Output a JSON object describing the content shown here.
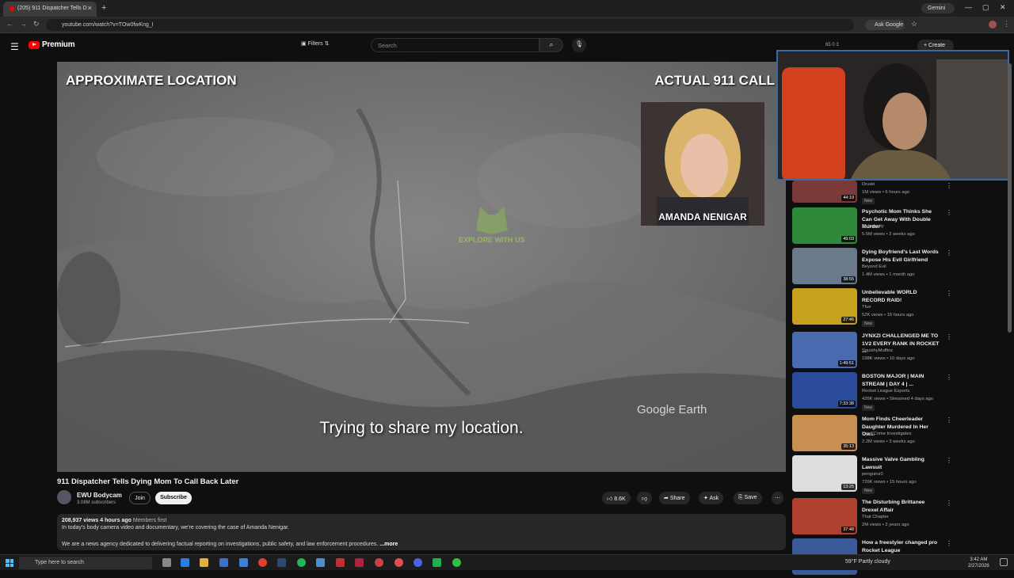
{
  "browser": {
    "tab_title": "(205) 911 Dispatcher Tells D",
    "url": "youtube.com/watch?v=TOw0fwKng_I",
    "gemini_label": "Gemini",
    "ask_google_label": "Ask Google"
  },
  "youtube": {
    "logo_text": "Premium",
    "filters_label": "Filters",
    "search_placeholder": "Search",
    "create_label": "Create",
    "header_stats": "65  0  3"
  },
  "video": {
    "overlay_left": "APPROXIMATE LOCATION",
    "overlay_right": "ACTUAL 911 CALL",
    "caller_name": "AMANDA NENIGAR",
    "watermark": "EXPLORE WITH US",
    "map_brand": "Google Earth",
    "caption": "Trying to share my location."
  },
  "info": {
    "title": "911 Dispatcher Tells Dying Mom To Call Back Later",
    "channel": "EWU Bodycam",
    "subscribers": "3.08M subscribers",
    "join_label": "Join",
    "subscribe_label": "Subscribe",
    "likes": "8.6K",
    "share_label": "Share",
    "ask_label": "Ask",
    "save_label": "Save",
    "desc_meta": "208,937 views  4 hours ago",
    "desc_members": "Members first",
    "desc_line1": "In today's body camera video and documentary, we're covering the case of Amanda Nenigar.",
    "desc_line2": "We are a news agency dedicated to delivering factual reporting on investigations, public safety, and law enforcement procedures.",
    "desc_more": "...more"
  },
  "sidebar": [
    {
      "title": "",
      "channel": "Druski",
      "views": "1M views • 6 hours ago",
      "duration": "44:19",
      "new": "New",
      "color": "#7a3a3a"
    },
    {
      "title": "Psychotic Mom Thinks She Can Get Away With Double Murder",
      "channel": "Dr Insanity",
      "views": "5.5M views • 2 weeks ago",
      "duration": "49:03",
      "new": "",
      "color": "#2e8a3a"
    },
    {
      "title": "Dying Boyfriend's Last Words Expose His Evil Girlfriend",
      "channel": "Beyond Evil",
      "views": "1.4M views • 1 month ago",
      "duration": "38:55",
      "new": "",
      "color": "#6a7a8a"
    },
    {
      "title": "Unbelievable WORLD RECORD RAID!",
      "channel": "Tfue",
      "views": "52K views • 15 hours ago",
      "duration": "27:46",
      "new": "New",
      "color": "#c8a020"
    },
    {
      "title": "JYNXZI CHALLENGED ME TO 1V2 EVERY RANK IN ROCKET ...",
      "channel": "SquishyMuffinz",
      "views": "198K views • 10 days ago",
      "duration": "1:49:51",
      "new": "",
      "color": "#4a6ab0"
    },
    {
      "title": "BOSTON MAJOR | MAIN STREAM | DAY 4 | ...",
      "channel": "Rocket League Esports",
      "views": "426K views • Streamed 4 days ago",
      "duration": "7:33:38",
      "new": "New",
      "color": "#2a4a9a"
    },
    {
      "title": "Mom Finds Cheerleader Daughter Murdered In Her Ow...",
      "channel": "Law&Crime Investigates",
      "views": "2.2M views • 3 weeks ago",
      "duration": "35:13",
      "new": "",
      "color": "#c89050"
    },
    {
      "title": "Massive Valve Gambling Lawsuit",
      "channel": "penguinz0",
      "views": "726K views • 15 hours ago",
      "duration": "13:25",
      "new": "New",
      "color": "#dddddd"
    },
    {
      "title": "The Disturbing Brittanee Drexel Affair",
      "channel": "That Chapter",
      "views": "2M views • 2 years ago",
      "duration": "37:48",
      "new": "",
      "color": "#b04030"
    },
    {
      "title": "How a freestyler changed pro Rocket League",
      "channel": "",
      "views": "",
      "duration": "",
      "new": "",
      "color": "#3a5a9a"
    }
  ],
  "taskbar": {
    "search_placeholder": "Type here to search",
    "weather": "59°F  Partly cloudy",
    "time": "3:42 AM",
    "date": "2/27/2026"
  }
}
